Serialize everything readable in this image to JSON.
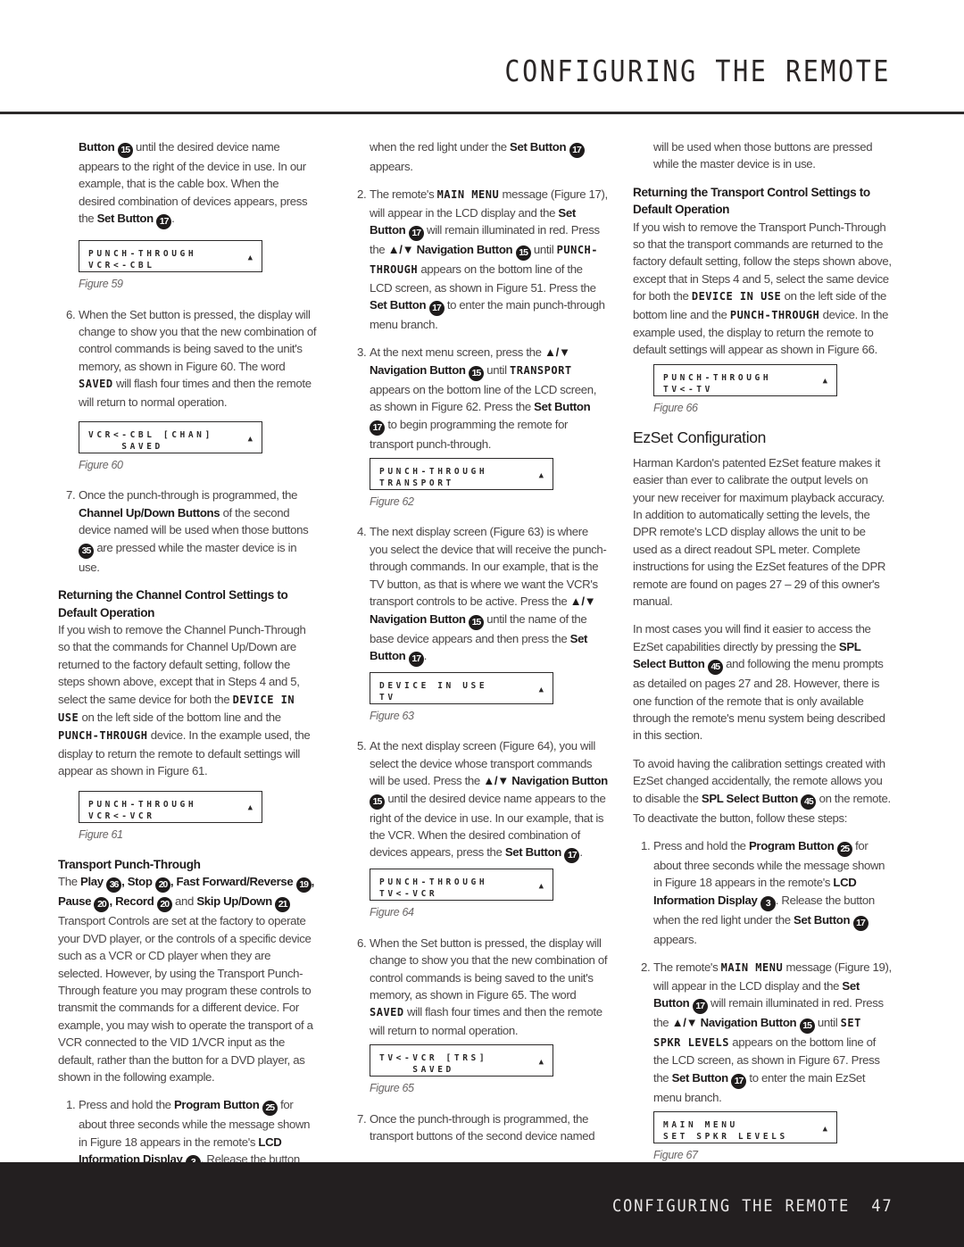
{
  "header": {
    "title": "CONFIGURING THE REMOTE"
  },
  "footer": {
    "section": "CONFIGURING THE REMOTE",
    "page": "47"
  },
  "col1": {
    "intro": {
      "b1": "Button",
      "n1": "15",
      "t1": " until the desired device name appears to the right of the device in use. In our example, that is the cable box. When the desired combination of devices appears, press the ",
      "b2": "Set Button",
      "n2": "17",
      "t2": "."
    },
    "fig59": {
      "l1": "PUNCH-THROUGH",
      "l2": "VCR<-CBL",
      "caption": "Figure 59"
    },
    "step6": {
      "n": "6.",
      "t1": "When the Set button is pressed, the display will change to show you that the new combination of control commands is being saved to the unit's memory, as shown in Figure 60. The word ",
      "lcd": "SAVED",
      "t2": " will flash four times and then the remote will return to normal operation."
    },
    "fig60": {
      "l1": "VCR<-CBL [CHAN]",
      "l2": "    SAVED",
      "caption": "Figure 60"
    },
    "step7": {
      "n": "7.",
      "t1": "Once the punch-through is programmed, the ",
      "b1": "Channel Up/Down Buttons",
      "t2": " of the second device named will be used when those buttons ",
      "n1": "35",
      "t3": " are pressed while the master device is in use."
    },
    "sec1": {
      "heading": "Returning the Channel Control Settings to Default Operation",
      "t1": "If you wish to remove the Channel Punch-Through so that the commands for Channel Up/Down are returned to the factory default setting, follow the steps shown above, except that in Steps 4 and 5, select the same device for both the ",
      "lcd1": "DEVICE IN USE",
      "t2": " on the left side of the bottom line and the ",
      "lcd2": "PUNCH-THROUGH",
      "t3": " device. In the example used, the display to return the remote to default settings will appear as shown in Figure 61."
    },
    "fig61": {
      "l1": "PUNCH-THROUGH",
      "l2": "VCR<-VCR",
      "caption": "Figure 61"
    },
    "sec2": {
      "heading": "Transport Punch-Through",
      "t0": "The ",
      "b1": "Play",
      "n1": "36",
      "b2": ", Stop",
      "n2": "20",
      "b3": ", Fast Forward/Reverse",
      "n3": "19",
      "b4": ", Pause",
      "n4": "20",
      "b5": ", Record",
      "n5": "20",
      "t1": " and ",
      "b6": "Skip Up/Down",
      "n6": "21",
      "t2": " Transport Controls are set at the factory to operate your DVD player, or the controls of a specific device such as a VCR or CD player when they are selected. However, by using the Transport Punch-Through feature you may program these controls to transmit the commands for a different device. For example, you may wish to operate the transport of a VCR connected to the VID 1/VCR input as the default, rather than the button for a DVD player, as shown in the following example."
    },
    "step1": {
      "n": "1.",
      "t1": "Press and hold the ",
      "b1": "Program Button",
      "n1": "25",
      "t2": " for about three seconds while the message shown in Figure 18 appears in the remote's ",
      "b2": "LCD Information Display",
      "n2": "3",
      "t3": ". Release the button"
    }
  },
  "col2": {
    "cont": {
      "t1": "when the red light under the ",
      "b1": "Set Button",
      "n1": "17",
      "t2": " appears."
    },
    "step2": {
      "n": "2.",
      "t1": "The remote's ",
      "lcd1": "MAIN MENU",
      "t2": " message (Figure 17), will appear in the LCD display and the ",
      "b1": "Set Button",
      "n1": "17",
      "t3": " will remain illuminated in red. Press the ",
      "b2": "▲/▼ Navigation Button",
      "n2": "15",
      "t4": " until ",
      "lcd2": "PUNCH-THROUGH",
      "t5": " appears on the bottom line of the LCD screen, as shown in Figure 51. Press the ",
      "b3": "Set Button",
      "n3": "17",
      "t6": " to enter the main punch-through menu branch."
    },
    "step3": {
      "n": "3.",
      "t1": "At the next menu screen, press the ",
      "b1": "▲/▼ Navigation Button",
      "n1": "15",
      "t2": " until ",
      "lcd1": "TRANSPORT",
      "t3": " appears on the bottom line of the LCD screen, as shown in Figure 62. Press the ",
      "b2": "Set Button",
      "n2": "17",
      "t4": " to begin programming the remote for transport punch-through."
    },
    "fig62": {
      "l1": "PUNCH-THROUGH",
      "l2": "TRANSPORT",
      "caption": "Figure 62"
    },
    "step4": {
      "n": "4.",
      "t1": "The next display screen (Figure 63) is where you select the device that will receive the punch-through commands. In our example, that is the TV button, as that is where we want the VCR's transport controls to be active. Press the ",
      "b1": "▲/▼ Navigation Button",
      "n1": "15",
      "t2": " until the name of the base device appears and then press the ",
      "b2": "Set Button",
      "n2": "17",
      "t3": "."
    },
    "fig63": {
      "l1": "DEVICE IN USE",
      "l2": "TV",
      "caption": "Figure 63"
    },
    "step5": {
      "n": "5.",
      "t1": "At the next display screen (Figure 64), you will select the device whose transport commands will be used. Press the ",
      "b1": "▲/▼ Navigation Button",
      "n1": "15",
      "t2": " until the desired device name appears to the right of the device in use. In our example, that is the VCR. When the desired combination of devices appears, press the ",
      "b2": "Set Button",
      "n2": "17",
      "t3": "."
    },
    "fig64": {
      "l1": "PUNCH-THROUGH",
      "l2": "TV<-VCR",
      "caption": "Figure 64"
    },
    "step6": {
      "n": "6.",
      "t1": "When the Set button is pressed, the display will change to show you that the new combination of control commands is being saved to the unit's memory, as shown in Figure 65. The word ",
      "lcd": "SAVED",
      "t2": " will flash four times and then the remote will return to normal operation."
    },
    "fig65": {
      "l1": "TV<-VCR [TRS]",
      "l2": "    SAVED",
      "caption": "Figure 65"
    },
    "step7": {
      "n": "7.",
      "t1": "Once the punch-through is programmed, the transport buttons of the second device named"
    }
  },
  "col3": {
    "cont": {
      "t1": "will be used when those buttons are pressed while the master device is in use."
    },
    "sec1": {
      "heading": "Returning the Transport Control Settings to Default Operation",
      "t1": "If you wish to remove the Transport Punch-Through so that the transport commands are returned to the factory default setting, follow the steps shown above, except that in Steps 4 and 5, select the same device for both the ",
      "lcd1": "DEVICE IN USE",
      "t2": " on the left side of the bottom line and the ",
      "lcd2": "PUNCH-THROUGH",
      "t3": " device. In the example used, the display to return the remote to default settings will appear as shown in Figure 66."
    },
    "fig66": {
      "l1": "PUNCH-THROUGH",
      "l2": "TV<-TV",
      "caption": "Figure 66"
    },
    "ezset": {
      "heading": "EzSet Configuration",
      "p1": "Harman Kardon's patented EzSet feature makes it easier than ever to calibrate the output levels on your new receiver for maximum playback accuracy. In addition to automatically setting the levels, the DPR remote's LCD display allows the unit to be used as a direct readout SPL meter. Complete instructions for using the EzSet features of the DPR remote are found on pages 27 – 29 of this owner's manual.",
      "p2a": "In most cases you will find it easier to access the EzSet capabilities directly by pressing the ",
      "p2b": "SPL Select Button",
      "p2n": "45",
      "p2c": " and following the menu prompts as detailed on pages 27 and 28. However, there is one function of the remote that is only available through the remote's menu system being described in this section.",
      "p3a": "To avoid having the calibration settings created with EzSet changed accidentally, the remote allows you to disable the ",
      "p3b": "SPL Select Button",
      "p3n": "45",
      "p3c": " on the remote. To deactivate the button, follow these steps:"
    },
    "step1": {
      "n": "1.",
      "t1": "Press and hold the ",
      "b1": "Program Button",
      "n1": "25",
      "t2": " for about three seconds while the message shown in Figure 18 appears in the remote's ",
      "b2": "LCD Information Display",
      "n2": "3",
      "t3": ". Release the button when the red light under the ",
      "b3": "Set Button",
      "n3": "17",
      "t4": " appears."
    },
    "step2": {
      "n": "2.",
      "t1": "The remote's ",
      "lcd1": "MAIN MENU",
      "t2": " message (Figure 19), will appear in the LCD display and the ",
      "b1": "Set Button",
      "n1": "17",
      "t3": " will remain illuminated in red. Press the ",
      "b2": "▲/▼ Navigation Button",
      "n2": "15",
      "t4": " until ",
      "lcd2": "SET SPKR LEVELS",
      "t5": " appears on the bottom line of the LCD screen, as shown in Figure 67. Press the ",
      "b3": "Set Button",
      "n3": "17",
      "t6": " to enter the main EzSet menu branch."
    },
    "fig67": {
      "l1": "MAIN MENU",
      "l2": "SET SPKR LEVELS",
      "caption": "Figure 67"
    }
  },
  "lcd_arrow": "▲"
}
